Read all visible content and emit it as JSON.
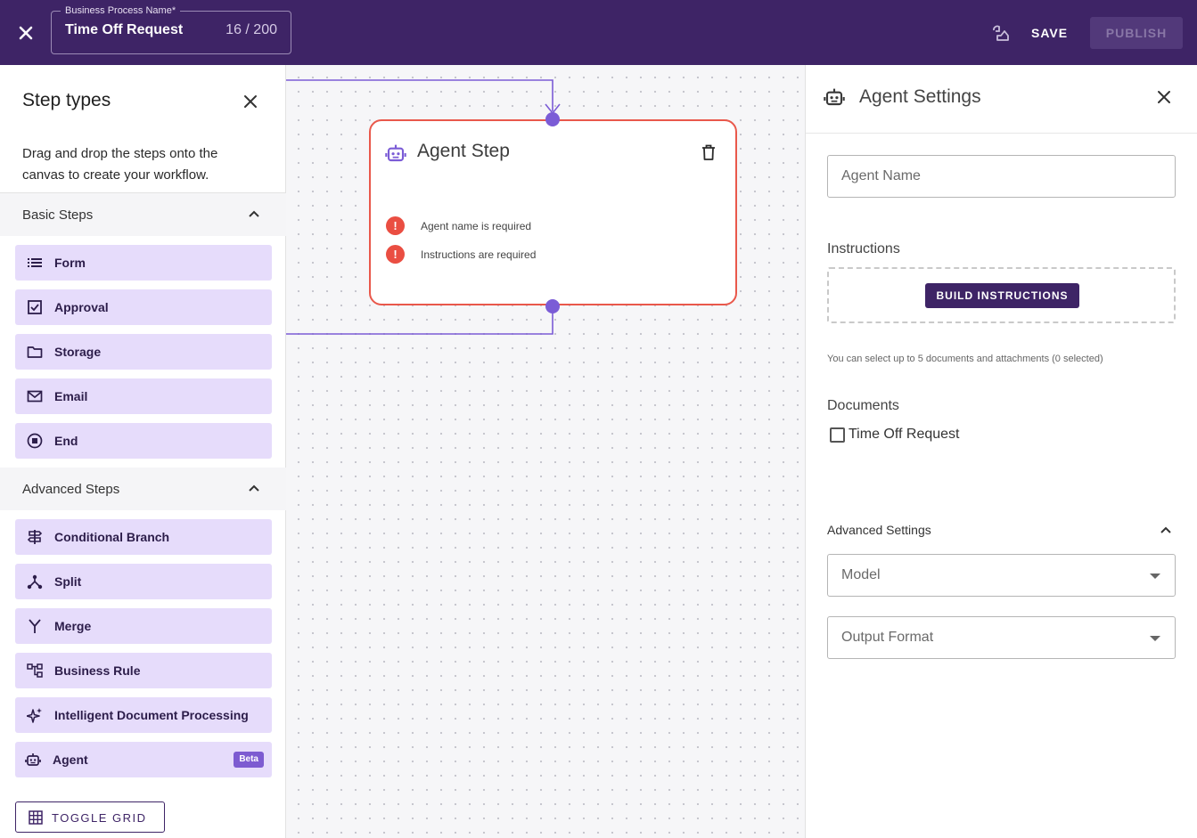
{
  "topbar": {
    "name_label": "Business Process Name*",
    "name_value": "Time Off Request",
    "char_count": "16 / 200",
    "save_label": "SAVE",
    "publish_label": "PUBLISH"
  },
  "left_panel": {
    "title": "Step types",
    "description": "Drag and drop the steps onto the canvas to create your workflow.",
    "basic_section": "Basic Steps",
    "basic_steps": [
      "Form",
      "Approval",
      "Storage",
      "Email",
      "End"
    ],
    "advanced_section": "Advanced Steps",
    "advanced_steps": [
      "Conditional Branch",
      "Split",
      "Merge",
      "Business Rule",
      "Intelligent Document Processing",
      "Agent"
    ],
    "agent_badge": "Beta",
    "toggle_grid_label": "TOGGLE GRID"
  },
  "canvas": {
    "card_title": "Agent Step",
    "errors": [
      "Agent name is required",
      "Instructions are required"
    ]
  },
  "right_panel": {
    "title": "Agent Settings",
    "agent_name_placeholder": "Agent Name",
    "instructions_label": "Instructions",
    "build_button": "BUILD INSTRUCTIONS",
    "hint": "You can select up to 5 documents and attachments (0 selected)",
    "documents_label": "Documents",
    "document_option": "Time Off Request",
    "advanced_label": "Advanced Settings",
    "model_placeholder": "Model",
    "output_placeholder": "Output Format"
  },
  "colors": {
    "topbar": "#3e2466",
    "step_item": "#e6dcfb",
    "accent": "#7b5cd6",
    "error": "#ea4e42"
  }
}
